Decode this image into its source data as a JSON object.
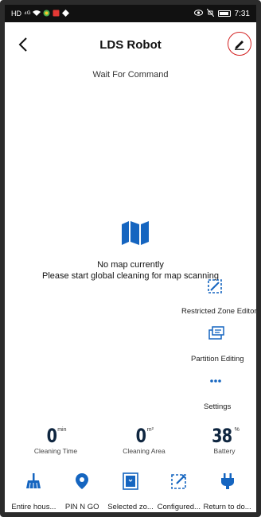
{
  "status_bar": {
    "time": "7:31",
    "signal": "⁴ᴳ",
    "hd": "HD"
  },
  "header": {
    "title": "LDS Robot"
  },
  "status": {
    "text": "Wait For Command"
  },
  "map": {
    "line1": "No map currently",
    "line2": "Please start global cleaning for map scanning"
  },
  "tools": {
    "restricted": "Restricted Zone Editor",
    "partition": "Partition Editing",
    "settings": "Settings"
  },
  "stats": {
    "time": {
      "value": "0",
      "unit": "min",
      "label": "Cleaning Time"
    },
    "area": {
      "value": "0",
      "unit": "m²",
      "label": "Cleaning Area"
    },
    "battery": {
      "value": "38",
      "unit": "%",
      "label": "Battery"
    }
  },
  "bottom_nav": {
    "entire": "Entire hous...",
    "pin": "PIN N GO",
    "selected": "Selected zo...",
    "configured": "Configured...",
    "return": "Return to do..."
  },
  "colors": {
    "accent": "#1565c0",
    "edit_ring": "#d32020",
    "stat_text": "#0f2640"
  }
}
